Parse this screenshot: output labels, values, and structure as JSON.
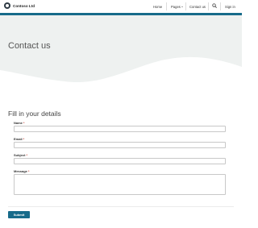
{
  "brand": {
    "name": "Contoso Ltd",
    "logo": "circle-logo-icon"
  },
  "nav": {
    "home": "Home",
    "pages": "Pages",
    "contact": "Contact us",
    "search_icon": "search-icon",
    "sign_in": "Sign in"
  },
  "colors": {
    "accent": "#176b8a",
    "hero_bg": "#eef1f0"
  },
  "hero": {
    "title": "Contact us"
  },
  "form": {
    "title": "Fill in your details",
    "fields": [
      {
        "label": "Name",
        "required_mark": "*"
      },
      {
        "label": "Email",
        "required_mark": "*"
      },
      {
        "label": "Subject",
        "required_mark": "*"
      },
      {
        "label": "Message",
        "required_mark": "*"
      }
    ],
    "submit_label": "Submit"
  }
}
